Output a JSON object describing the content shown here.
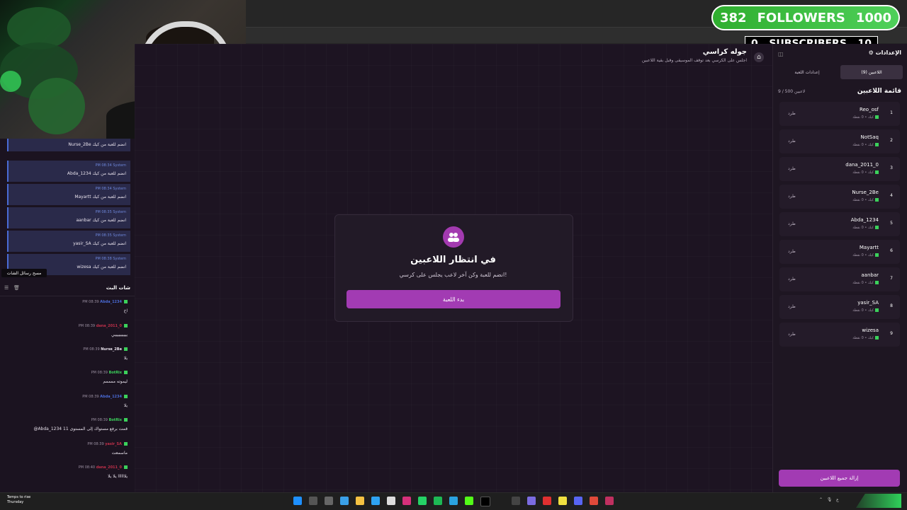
{
  "overlay": {
    "followers": {
      "current": "382",
      "label": "FOLLOWERS",
      "goal": "1000"
    },
    "subscribers": {
      "current": "0",
      "label": "SUBSCRIBERS",
      "goal": "10"
    }
  },
  "game": {
    "title": "جوله كراسي",
    "subtitle": "اجلس على الكرسي بعد توقف الموسيقى وقبل بقية اللاعبين",
    "waiting_title": "في انتظار اللاعبين",
    "waiting_sub": "انضم للعبة وكن آخر لاعب يجلس على كرسي!",
    "start_button": "بدء اللعبة"
  },
  "right_panel": {
    "settings_title": "الإعدادات",
    "tabs": [
      {
        "label": "اللاعبين (9)",
        "active": true
      },
      {
        "label": "إعدادات اللعبة",
        "active": false
      }
    ],
    "list_title": "قائمة اللاعبين",
    "list_count": "9 / 500 لاعبين",
    "kick_label": "طرد",
    "meta_label": "كيك • 0 نقطة",
    "players": [
      {
        "num": "1",
        "name": "Reo_osf"
      },
      {
        "num": "2",
        "name": "NotSaq"
      },
      {
        "num": "3",
        "name": "dana_2011_0"
      },
      {
        "num": "4",
        "name": "Nurse_2Be"
      },
      {
        "num": "5",
        "name": "Abda_1234"
      },
      {
        "num": "6",
        "name": "Mayartt"
      },
      {
        "num": "7",
        "name": "aanbar"
      },
      {
        "num": "8",
        "name": "yasir_SA"
      },
      {
        "num": "9",
        "name": "wizesa"
      }
    ],
    "clear_button": "إزالة جميع اللاعبين"
  },
  "left_panel": {
    "system_messages": [
      {
        "meta": "PM 08:34 System",
        "text": "Nurse_2Be انضم للعبة من كيك"
      },
      {
        "meta": "PM 08:34 System",
        "text": "Abda_1234 انضم للعبة من كيك"
      },
      {
        "meta": "PM 08:34 System",
        "text": "Mayartt انضم للعبة من كيك"
      },
      {
        "meta": "PM 08:35 System",
        "text": "aanbar انضم للعبة من كيك"
      },
      {
        "meta": "PM 08:35 System",
        "text": "yasir_SA انضم للعبة من كيك"
      },
      {
        "meta": "PM 08:38 System",
        "text": "wizesa انضم للعبة من كيك"
      }
    ],
    "tooltip": "مسح رسائل الشات",
    "chat_title": "شات البث",
    "chat_messages": [
      {
        "time": "PM 08:39",
        "user": "Abda_1234",
        "color": "#4a6bd6",
        "text": "اخ"
      },
      {
        "time": "PM 08:39",
        "user": "dana_2011_0",
        "color": "#c0304a",
        "text": "ييييييييييي"
      },
      {
        "time": "PM 08:39",
        "user": "Nurse_2Be",
        "color": "#e8e2ec",
        "text": "يلا"
      },
      {
        "time": "PM 08:39",
        "user": "BotRix",
        "color": "#3bd15b",
        "text": "ليموته ممممم"
      },
      {
        "time": "PM 08:39",
        "user": "Abda_1234",
        "color": "#4a6bd6",
        "text": "يلا"
      },
      {
        "time": "PM 08:39",
        "user": "BotRix",
        "color": "#3bd15b",
        "text": "@Abda_1234 قمت برفع مستواك إلى المستوى 11"
      },
      {
        "time": "PM 08:39",
        "user": "yasir_SA",
        "color": "#c0304a",
        "text": "ماسمعت"
      },
      {
        "time": "PM 08:40",
        "user": "dana_2011_0",
        "color": "#c0304a",
        "text": "يلاااااا يلا يلا"
      }
    ]
  },
  "taskbar": {
    "weather_line1": "Temps to rise",
    "weather_line2": "Thursday"
  }
}
